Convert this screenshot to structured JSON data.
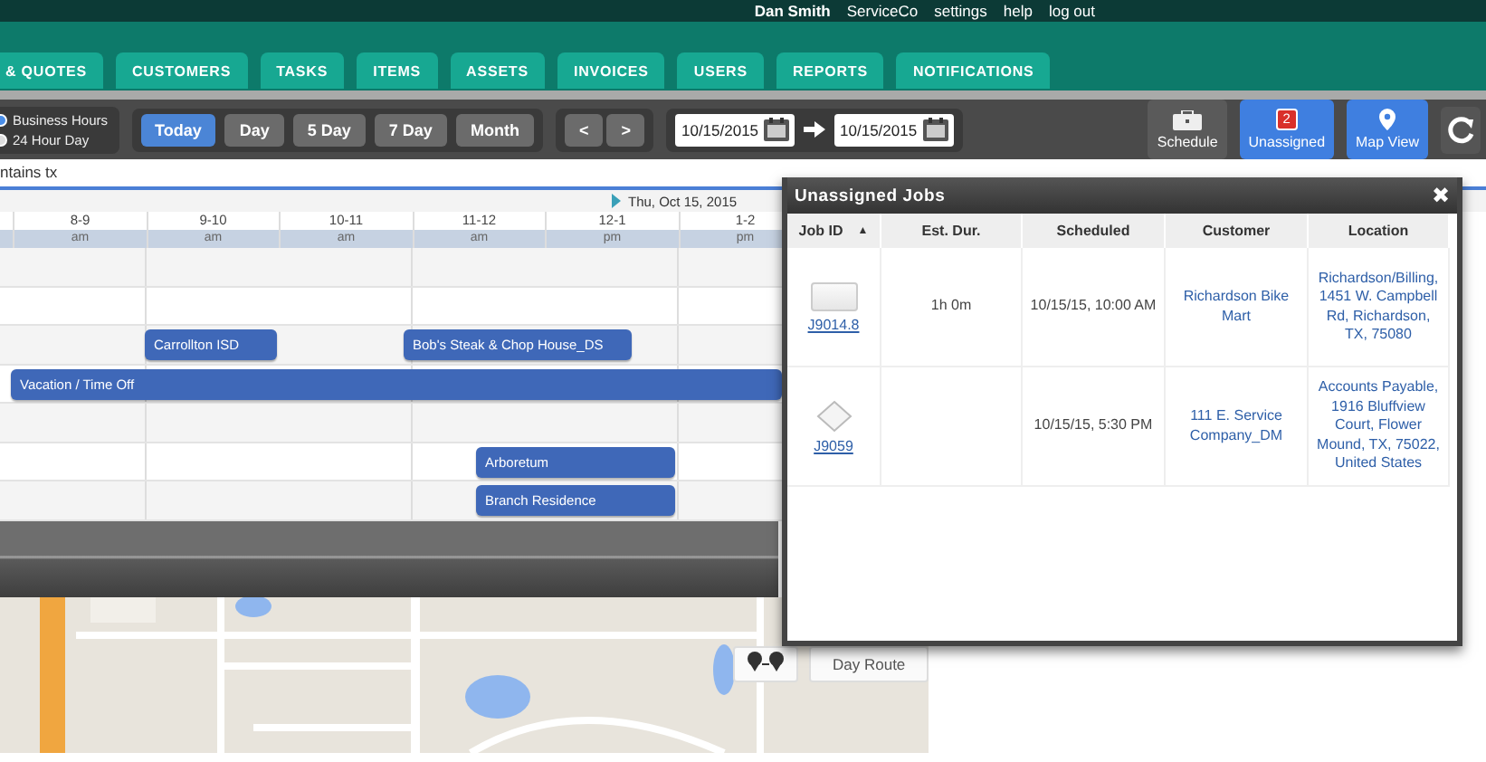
{
  "user_menu": {
    "user": "Dan Smith",
    "company": "ServiceCo",
    "links": [
      "settings",
      "help",
      "log out"
    ]
  },
  "tabs": [
    {
      "label": "& QUOTES",
      "selected": false
    },
    {
      "label": "CUSTOMERS",
      "selected": false
    },
    {
      "label": "TASKS",
      "selected": false
    },
    {
      "label": "ITEMS",
      "selected": false
    },
    {
      "label": "ASSETS",
      "selected": false
    },
    {
      "label": "INVOICES",
      "selected": false
    },
    {
      "label": "USERS",
      "selected": false
    },
    {
      "label": "REPORTS",
      "selected": false
    },
    {
      "label": "NOTIFICATIONS",
      "selected": false
    }
  ],
  "toolbar": {
    "hours_options": [
      {
        "label": "Business Hours",
        "selected": true
      },
      {
        "label": "24 Hour Day",
        "selected": false
      }
    ],
    "views": [
      {
        "label": "Today",
        "selected": true
      },
      {
        "label": "Day",
        "selected": false
      },
      {
        "label": "5 Day",
        "selected": false
      },
      {
        "label": "7 Day",
        "selected": false
      },
      {
        "label": "Month",
        "selected": false
      }
    ],
    "nav": [
      "<",
      ">"
    ],
    "date_from": "10/15/2015",
    "date_to": "10/15/2015",
    "actions": [
      {
        "kind": "schedule",
        "label": "Schedule",
        "selected": false
      },
      {
        "kind": "unassigned",
        "label": "Unassigned",
        "badge": "2",
        "selected": true
      },
      {
        "kind": "map",
        "label": "Map View",
        "selected": true
      }
    ]
  },
  "filter": "ntains tx",
  "calendar": {
    "date": "Thu, Oct 15, 2015",
    "hours": [
      {
        "range": "8-9",
        "period": "am"
      },
      {
        "range": "9-10",
        "period": "am"
      },
      {
        "range": "10-11",
        "period": "am"
      },
      {
        "range": "11-12",
        "period": "am"
      },
      {
        "range": "12-1",
        "period": "pm"
      },
      {
        "range": "1-2",
        "period": "pm"
      }
    ],
    "rows": [
      {
        "events": []
      },
      {
        "events": []
      },
      {
        "events": [
          {
            "title": "Carrollton ISD"
          },
          {
            "title": "Bob's Steak & Chop House_DS"
          }
        ]
      },
      {
        "events": [
          {
            "title": "Vacation / Time Off"
          }
        ]
      },
      {
        "events": []
      },
      {
        "events": [
          {
            "title": "Arboretum"
          }
        ]
      },
      {
        "events": [
          {
            "title": "Branch Residence"
          }
        ]
      }
    ]
  },
  "map": {
    "kind": "picture",
    "button": "Day Route"
  },
  "unassigned_jobs": {
    "title": "Unassigned Jobs",
    "close": "✖",
    "columns": [
      {
        "label": "Job ID",
        "sort": "▲"
      },
      {
        "label": "Est. Dur."
      },
      {
        "label": "Scheduled"
      },
      {
        "label": "Customer"
      },
      {
        "label": "Location"
      }
    ],
    "rows": [
      {
        "kind": "square",
        "job_id": "J9014.8",
        "duration": "1h 0m",
        "scheduled": "10/15/15, 10:00 AM",
        "customer": "Richardson Bike Mart",
        "location": "Richardson/Billing, 1451 W. Campbell Rd, Richardson, TX, 75080"
      },
      {
        "kind": "diamond",
        "job_id": "J9059",
        "scheduled": "10/15/15, 5:30 PM",
        "customer": "111 E. Service Company_DM",
        "location": "Accounts Payable, 1916 Bluffview Court, Flower Mound, TX, 75022, United States"
      }
    ]
  }
}
